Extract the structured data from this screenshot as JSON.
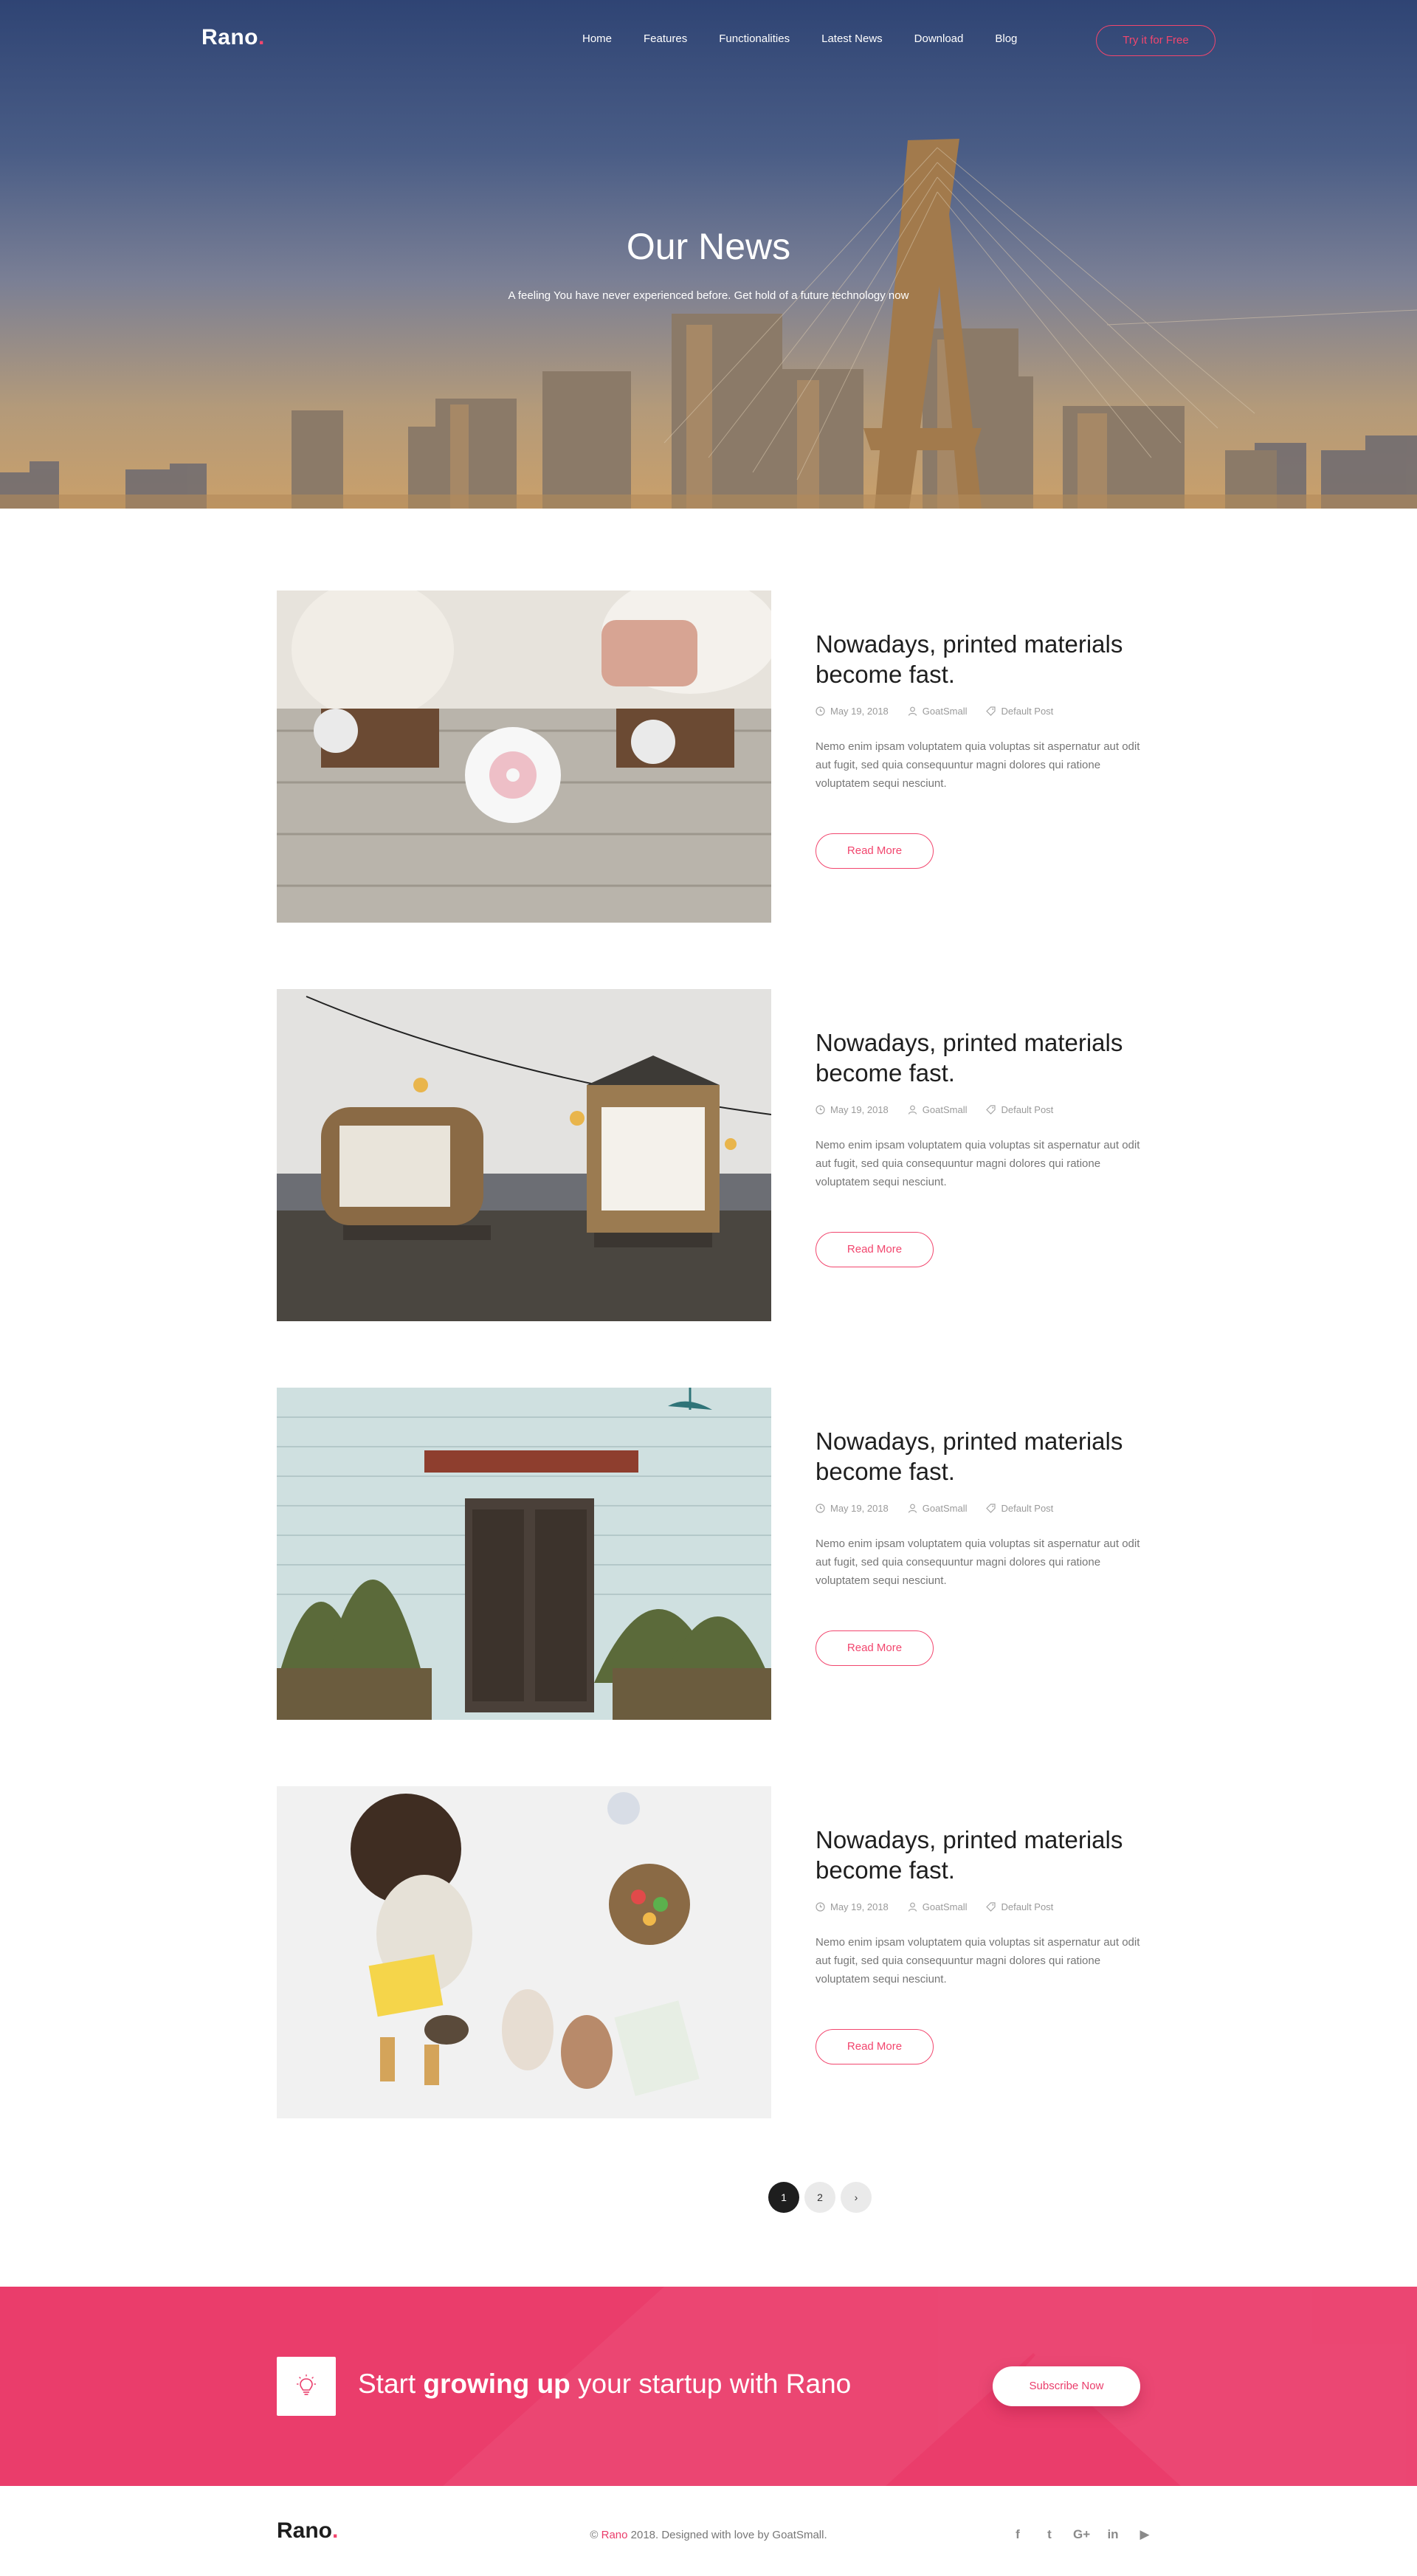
{
  "brand": {
    "name": "Rano",
    "dot": ".",
    "accent": "#f2466e"
  },
  "nav": {
    "links": [
      "Home",
      "Features",
      "Functionalities",
      "Latest News",
      "Download",
      "Blog"
    ],
    "cta": "Try it for Free"
  },
  "hero": {
    "title": "Our News",
    "subtitle": "A feeling You have never experienced before. Get hold of a future technology now"
  },
  "posts": [
    {
      "title": "Nowadays, printed materials become fast.",
      "date": "May 19, 2018",
      "author": "GoatSmall",
      "category": "Default Post",
      "excerpt": "Nemo enim ipsam voluptatem quia voluptas sit aspernatur aut odit aut fugit, sed quia consequuntur magni dolores qui ratione voluptatem sequi nesciunt.",
      "read_more": "Read More"
    },
    {
      "title": "Nowadays, printed materials become fast.",
      "date": "May 19, 2018",
      "author": "GoatSmall",
      "category": "Default Post",
      "excerpt": "Nemo enim ipsam voluptatem quia voluptas sit aspernatur aut odit aut fugit, sed quia consequuntur magni dolores qui ratione voluptatem sequi nesciunt.",
      "read_more": "Read More"
    },
    {
      "title": "Nowadays, printed materials become fast.",
      "date": "May 19, 2018",
      "author": "GoatSmall",
      "category": "Default Post",
      "excerpt": "Nemo enim ipsam voluptatem quia voluptas sit aspernatur aut odit aut fugit, sed quia consequuntur magni dolores qui ratione voluptatem sequi nesciunt.",
      "read_more": "Read More"
    },
    {
      "title": "Nowadays, printed materials become fast.",
      "date": "May 19, 2018",
      "author": "GoatSmall",
      "category": "Default Post",
      "excerpt": "Nemo enim ipsam voluptatem quia voluptas sit aspernatur aut odit aut fugit, sed quia consequuntur magni dolores qui ratione voluptatem sequi nesciunt.",
      "read_more": "Read More"
    }
  ],
  "pagination": {
    "pages": [
      "1",
      "2"
    ],
    "current": "1",
    "next": "›"
  },
  "cta": {
    "text_before": "Start ",
    "text_bold": "growing up",
    "text_after": " your startup with Rano",
    "button": "Subscribe Now",
    "icon": "lightbulb-icon",
    "color": "#ea3d6b"
  },
  "footer": {
    "copyright_prefix": "© ",
    "copyright_brand": "Rano",
    "copyright_suffix": " 2018. Designed with love by GoatSmall.",
    "socials": [
      "facebook-icon",
      "twitter-icon",
      "google-plus-icon",
      "linkedin-icon",
      "youtube-icon"
    ],
    "social_glyphs": [
      "f",
      "t",
      "G+",
      "in",
      "▶"
    ]
  }
}
